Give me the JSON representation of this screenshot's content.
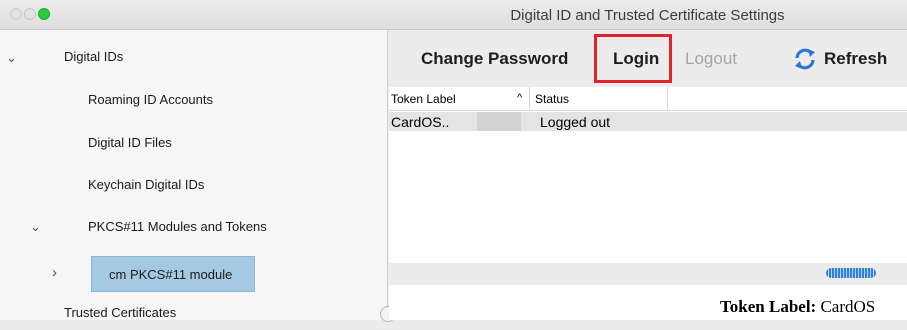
{
  "window": {
    "title": "Digital ID and Trusted Certificate Settings"
  },
  "sidebar": {
    "items": [
      {
        "label": "Digital IDs",
        "expanded": true
      },
      {
        "label": "Roaming ID Accounts"
      },
      {
        "label": "Digital ID Files"
      },
      {
        "label": "Keychain Digital IDs"
      },
      {
        "label": "PKCS#11 Modules and Tokens",
        "expanded": true
      },
      {
        "label": "cm PKCS#11 module",
        "selected": true,
        "expanded": false
      },
      {
        "label": "Trusted Certificates"
      }
    ]
  },
  "toolbar": {
    "change_password": "Change Password",
    "login": "Login",
    "logout": "Logout",
    "refresh": "Refresh"
  },
  "table": {
    "columns": [
      "Token Label",
      "Status"
    ],
    "sort_indicator": "^",
    "rows": [
      {
        "token_label": "CardOS..",
        "status": "Logged out"
      }
    ]
  },
  "details": {
    "token_label_key": "Token Label:",
    "token_label_value": "CardOS"
  },
  "colors": {
    "highlight_box": "#e3232b",
    "selection": "#a6c9e3",
    "splitter_handle": "#2f7ee0"
  }
}
